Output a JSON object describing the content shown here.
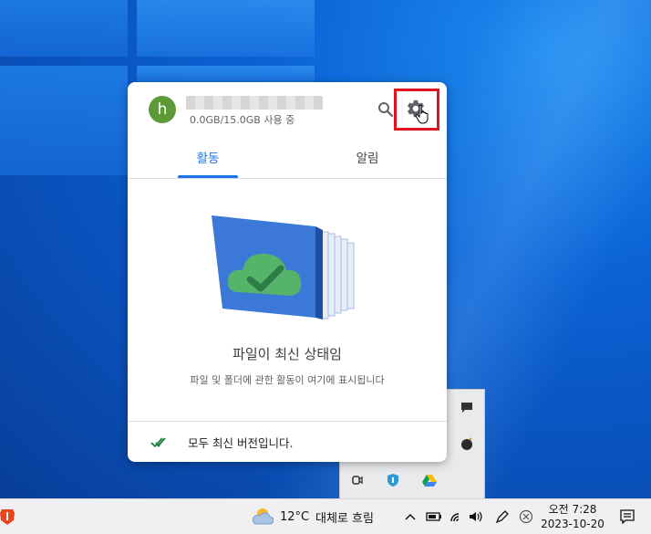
{
  "popup": {
    "avatar_letter": "h",
    "storage_text": "0.0GB/15.0GB 사용 중",
    "tabs": [
      {
        "label": "활동",
        "active": true
      },
      {
        "label": "알림",
        "active": false
      }
    ],
    "empty_title": "파일이 최신 상태임",
    "empty_subtitle": "파일 및 폴더에 관한 활동이 여기에 표시됩니다",
    "footer_text": "모두 최신 버전입니다."
  },
  "taskbar": {
    "weather_temp": "12°C",
    "weather_desc": "대체로 흐림",
    "time": "오전 7:28",
    "date": "2023-10-20"
  },
  "colors": {
    "accent": "#1a73e8",
    "highlight_box": "#e0141e",
    "avatar_bg": "#5b9a37"
  }
}
